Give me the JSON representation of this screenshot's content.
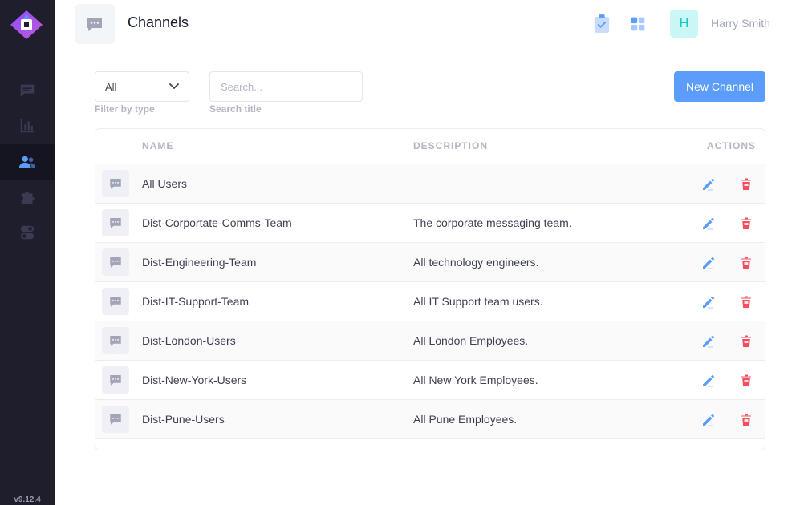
{
  "sidebar": {
    "version": "v9.12.4",
    "items": [
      {
        "icon": "message-icon",
        "name": "sidebar-item-messages"
      },
      {
        "icon": "chart-icon",
        "name": "sidebar-item-analytics"
      },
      {
        "icon": "users-icon",
        "name": "sidebar-item-channels"
      },
      {
        "icon": "puzzle-icon",
        "name": "sidebar-item-integrations"
      },
      {
        "icon": "toggle-icon",
        "name": "sidebar-item-settings"
      }
    ]
  },
  "header": {
    "title": "Channels",
    "user": {
      "initial": "H",
      "name": "Harry Smith"
    }
  },
  "filters": {
    "type_value": "All",
    "type_label": "Filter by type",
    "search_placeholder": "Search...",
    "search_label": "Search title",
    "new_button": "New Channel"
  },
  "table": {
    "headers": {
      "name": "NAME",
      "description": "DESCRIPTION",
      "actions": "ACTIONS"
    },
    "rows": [
      {
        "name": "All Users",
        "description": ""
      },
      {
        "name": "Dist-Corportate-Comms-Team",
        "description": "The corporate messaging team."
      },
      {
        "name": "Dist-Engineering-Team",
        "description": "All technology engineers."
      },
      {
        "name": "Dist-IT-Support-Team",
        "description": "All IT Support team users."
      },
      {
        "name": "Dist-London-Users",
        "description": "All London Employees."
      },
      {
        "name": "Dist-New-York-Users",
        "description": "All New York Employees."
      },
      {
        "name": "Dist-Pune-Users",
        "description": "All Pune Employees."
      }
    ]
  },
  "colors": {
    "sidebar_bg": "#1e1e2d",
    "primary": "#5c9dfc",
    "danger": "#f64e60",
    "avatar_bg": "#c9f7f5"
  }
}
